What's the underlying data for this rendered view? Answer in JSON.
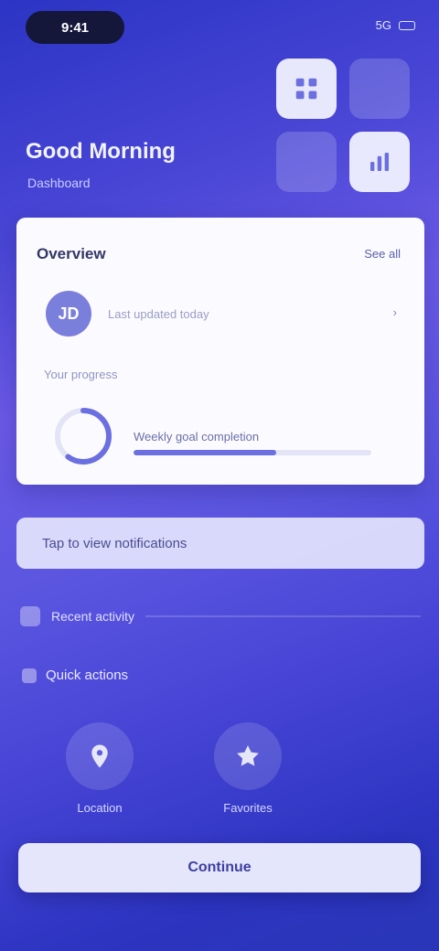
{
  "status_bar": {
    "time": "9:41",
    "signal": "5G"
  },
  "header": {
    "title": "Good Morning",
    "subtitle": "Dashboard"
  },
  "card": {
    "title": "Overview",
    "action_label": "See all",
    "avatar_initials": "JD",
    "meta_text": "Last updated today",
    "meta_right": "›",
    "section_label": "Your progress",
    "progress_text": "Weekly goal completion",
    "progress_fraction": 0.6
  },
  "notice": {
    "text": "Tap to view notifications"
  },
  "info_row": {
    "text": "Recent activity"
  },
  "section": {
    "heading": "Quick actions"
  },
  "actions": [
    {
      "label": "Location"
    },
    {
      "label": "Favorites"
    }
  ],
  "bottom_button": {
    "label": "Continue"
  },
  "colors": {
    "accent": "#6b6fe0",
    "background_start": "#2b34c4",
    "background_mid": "#6a5ae6"
  },
  "icons": {
    "tile_1": "grid-icon",
    "tile_2": "chart-icon",
    "action_1": "location-icon",
    "action_2": "star-icon"
  }
}
